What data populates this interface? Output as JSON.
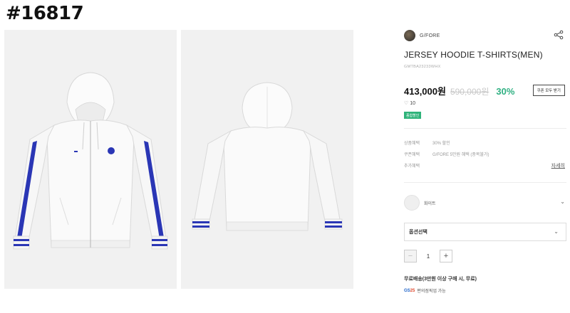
{
  "page": {
    "tag": "#16817"
  },
  "gallery": {
    "images": [
      {
        "alt": "front",
        "view": "front"
      },
      {
        "alt": "back",
        "view": "back"
      }
    ]
  },
  "product": {
    "brand": "G/FORE",
    "title": "JERSEY HOODIE T-SHIRTS(MEN)",
    "code": "GMTBA23233WHX",
    "price": "413,000원",
    "original_price": "590,000원",
    "discount": "30%",
    "coupon_button": "쿠폰 모두 받기",
    "likes": "10",
    "badge": "종합할인"
  },
  "benefits": [
    {
      "label": "상품혜택",
      "value": "30% 할인"
    },
    {
      "label": "쿠폰혜택",
      "value": "G/FORE 5만원 혜택 (중복불가)"
    },
    {
      "label": "추가혜택",
      "value": ""
    }
  ],
  "detail_link": "자세히",
  "color": {
    "name": "화이트"
  },
  "option": {
    "label": "옵션선택"
  },
  "quantity": {
    "value": "1",
    "minus": "−",
    "plus": "+"
  },
  "shipping": {
    "text": "무료배송(3만원 이상 구매 시, 무료)"
  },
  "pickup": {
    "logo_g": "GS",
    "logo_n": "25",
    "text": "편의점픽업 가능"
  },
  "colors": {
    "accent_green": "#2fb082",
    "badge_green": "#2fb37a",
    "stripe_blue": "#2a36b5"
  },
  "icons": {
    "share": "share-icon",
    "heart": "heart-icon",
    "chevron": "chevron-down-icon"
  }
}
